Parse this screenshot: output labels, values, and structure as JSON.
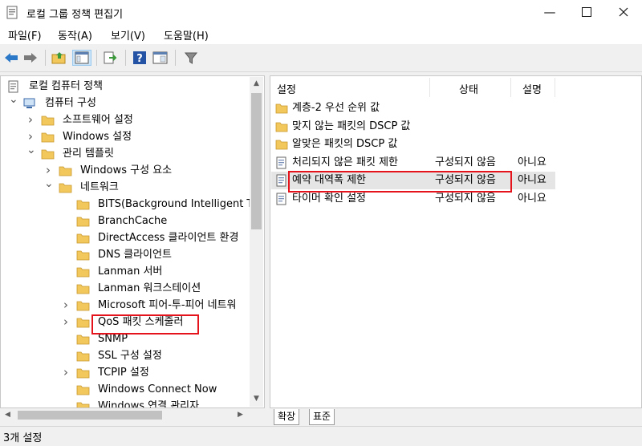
{
  "window": {
    "title": "로컬 그룹 정책 편집기",
    "min_icon": "minimize-icon",
    "max_icon": "maximize-icon",
    "close_icon": "close-icon"
  },
  "menu": [
    "파일(F)",
    "동작(A)",
    "보기(V)",
    "도움말(H)"
  ],
  "toolbar": [
    "back-arrow-icon",
    "forward-arrow-icon",
    "up-folder-icon",
    "show-hide-tree-icon",
    "export-list-icon",
    "help-icon",
    "properties-icon",
    "filter-icon"
  ],
  "tree": [
    {
      "label": "로컬 컴퓨터 정책",
      "icon": "policy-doc-icon"
    },
    {
      "label": "컴퓨터 구성",
      "icon": "computer-icon"
    },
    {
      "label": "소프트웨어 설정",
      "icon": "folder-icon"
    },
    {
      "label": "Windows 설정",
      "icon": "folder-icon"
    },
    {
      "label": "관리 템플릿",
      "icon": "folder-icon"
    },
    {
      "label": "Windows 구성 요소",
      "icon": "folder-icon"
    },
    {
      "label": "네트워크",
      "icon": "folder-icon"
    },
    {
      "label": "BITS(Background Intelligent Tr",
      "icon": "folder-icon"
    },
    {
      "label": "BranchCache",
      "icon": "folder-icon"
    },
    {
      "label": "DirectAccess 클라이언트 환경",
      "icon": "folder-icon"
    },
    {
      "label": "DNS 클라이언트",
      "icon": "folder-icon"
    },
    {
      "label": "Lanman 서버",
      "icon": "folder-icon"
    },
    {
      "label": "Lanman 워크스테이션",
      "icon": "folder-icon"
    },
    {
      "label": "Microsoft 피어-투-피어 네트워",
      "icon": "folder-icon"
    },
    {
      "label": "QoS 패킷 스케줄러",
      "icon": "folder-icon"
    },
    {
      "label": "SNMP",
      "icon": "folder-icon"
    },
    {
      "label": "SSL 구성 설정",
      "icon": "folder-icon"
    },
    {
      "label": "TCPIP 설정",
      "icon": "folder-icon"
    },
    {
      "label": "Windows Connect Now",
      "icon": "folder-icon"
    },
    {
      "label": "Windows 연결 관리자",
      "icon": "folder-icon"
    }
  ],
  "list": {
    "headers": [
      "설정",
      "상태",
      "설명"
    ],
    "rows": [
      {
        "name": "계층-2 우선 순위 값",
        "status": "",
        "desc": "",
        "icon": "folder-icon"
      },
      {
        "name": "맞지 않는 패킷의 DSCP 값",
        "status": "",
        "desc": "",
        "icon": "folder-icon"
      },
      {
        "name": "알맞은 패킷의 DSCP 값",
        "status": "",
        "desc": "",
        "icon": "folder-icon"
      },
      {
        "name": "처리되지 않은 패킷 제한",
        "status": "구성되지 않음",
        "desc": "아니요",
        "icon": "policy-setting-icon"
      },
      {
        "name": "예약 대역폭 제한",
        "status": "구성되지 않음",
        "desc": "아니요",
        "icon": "policy-setting-icon"
      },
      {
        "name": "타이머 확인 설정",
        "status": "구성되지 않음",
        "desc": "아니요",
        "icon": "policy-setting-icon"
      }
    ]
  },
  "tabs": [
    "확장",
    "표준"
  ],
  "status": "3개 설정",
  "colors": {
    "highlight": "#e5141c",
    "folder": "#f2c75c",
    "selection": "#e5e5e5"
  }
}
